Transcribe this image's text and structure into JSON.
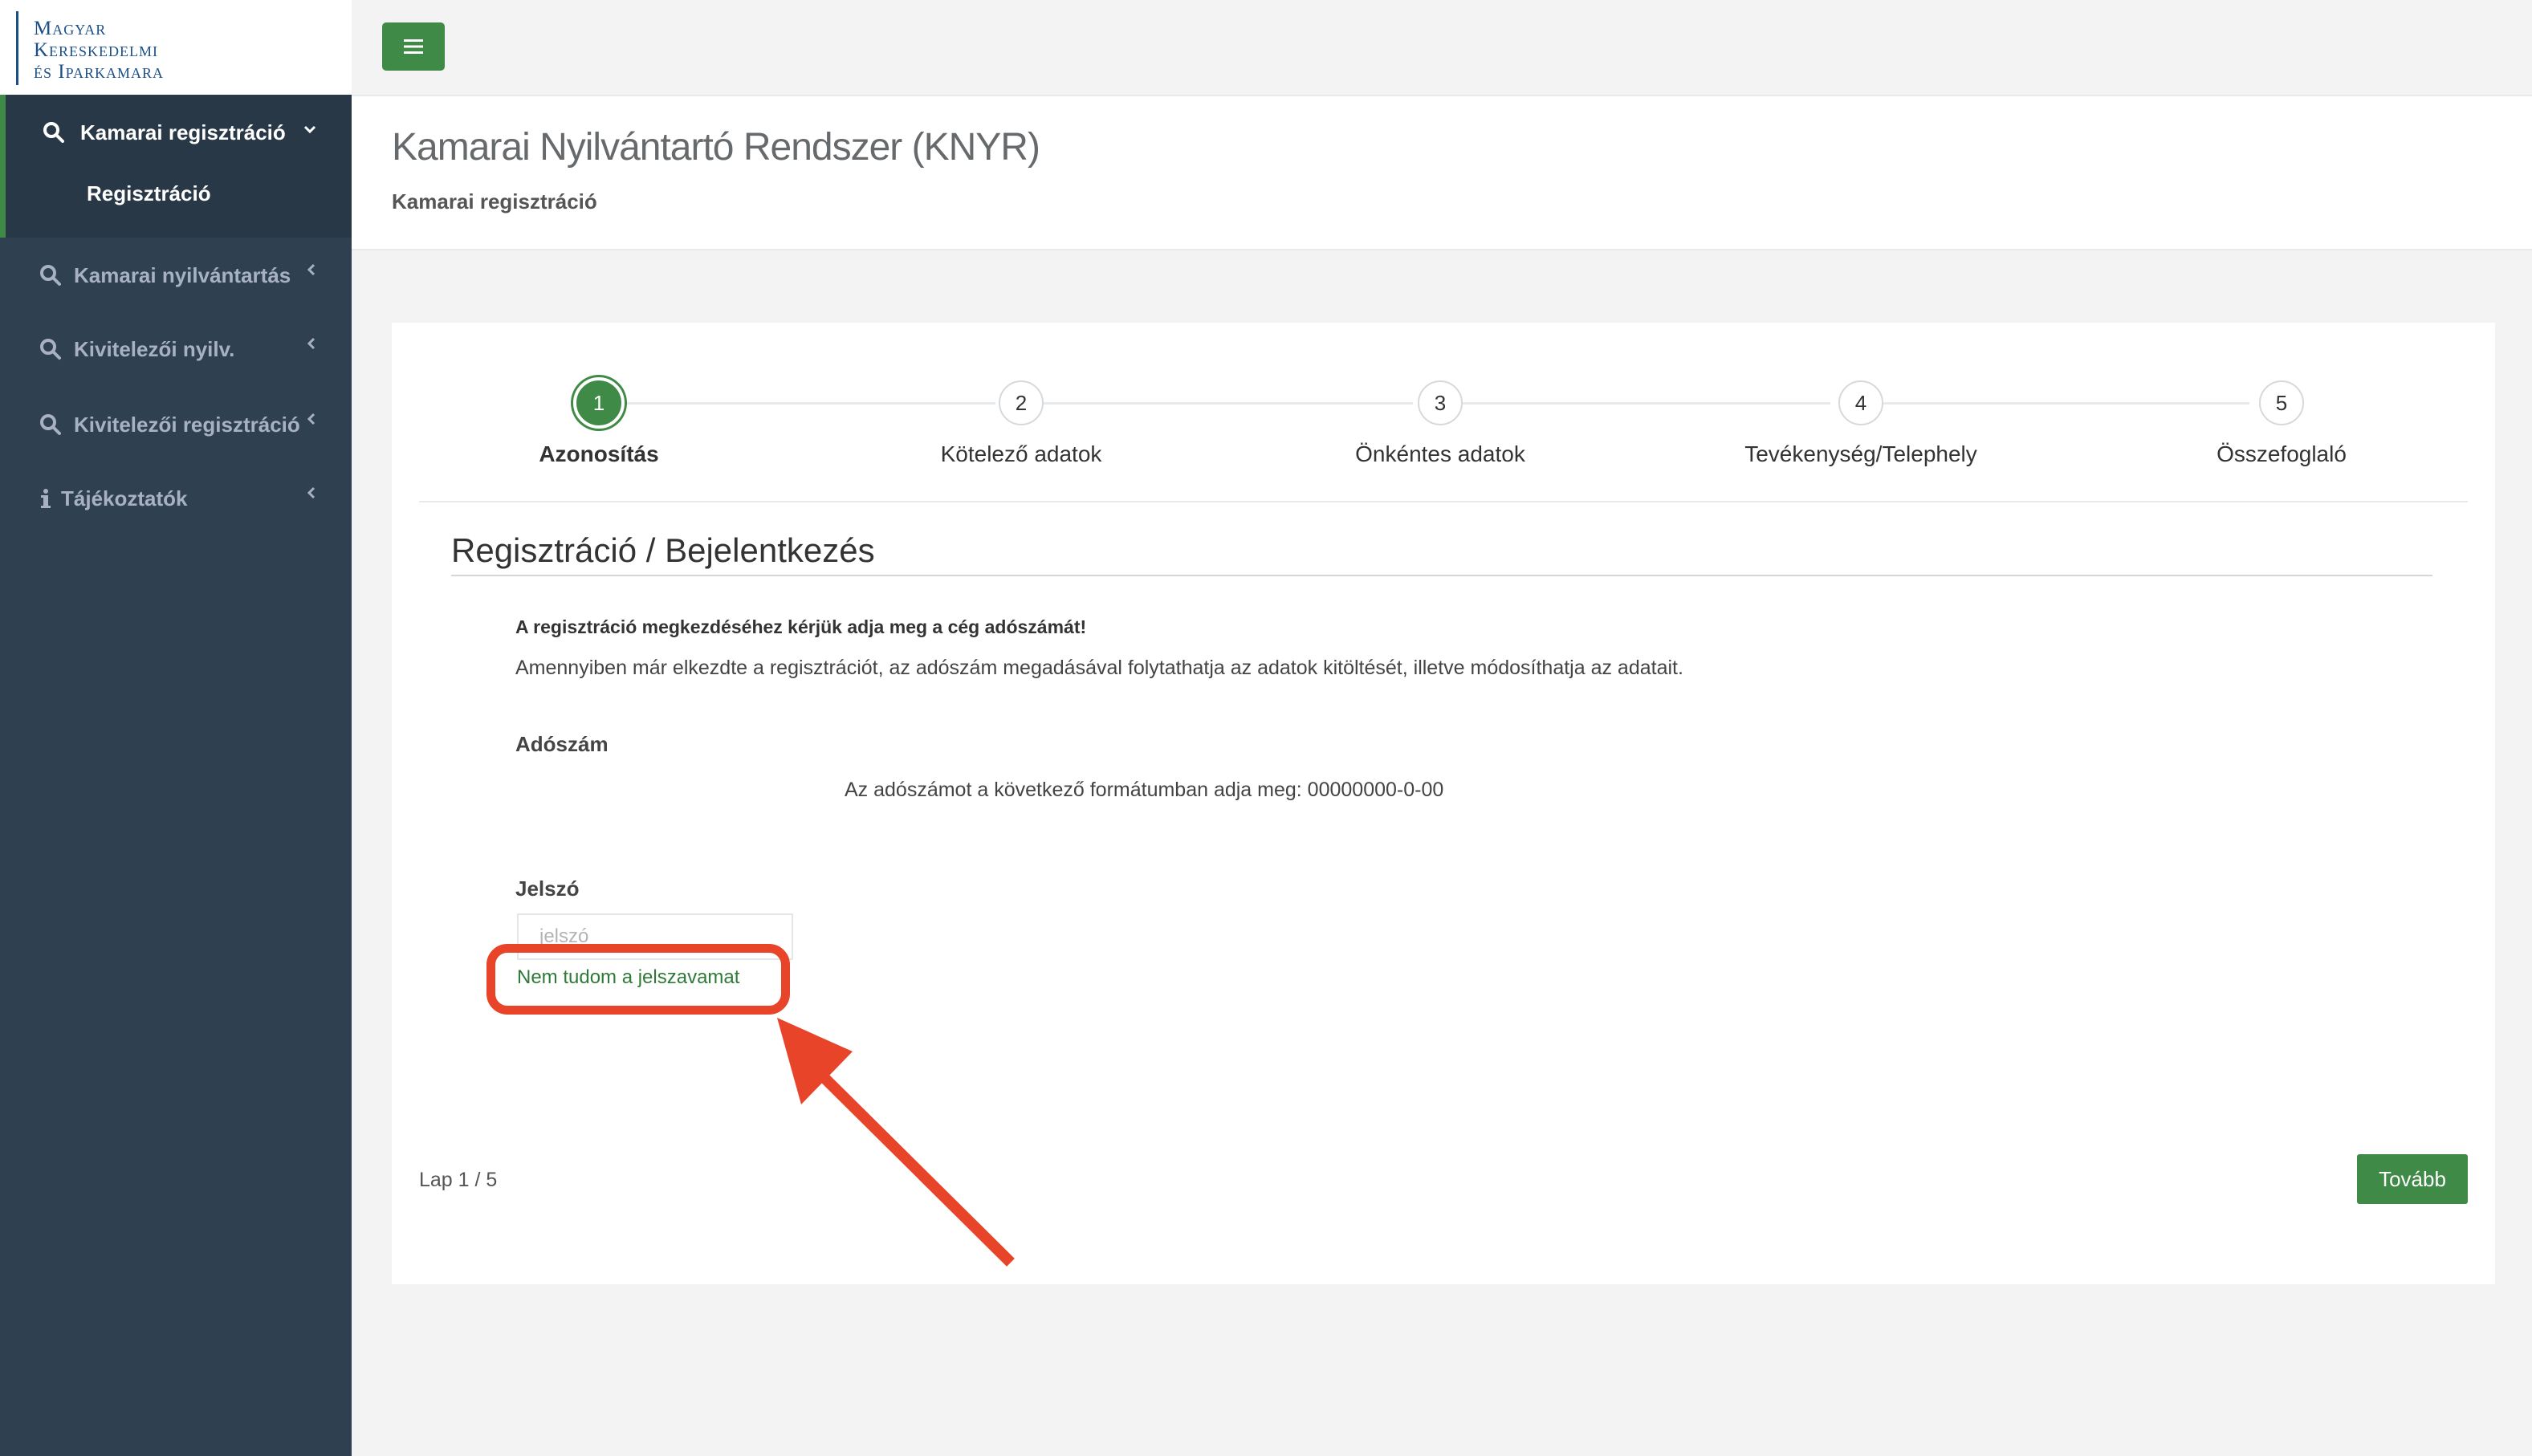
{
  "logo": {
    "lines": [
      "Magyar",
      "Kereskedelmi",
      "és Iparkamara"
    ]
  },
  "sidebar": {
    "items": [
      {
        "label": "Kamarai regisztráció",
        "icon": "search-icon",
        "arrow": "chevron-down-icon",
        "active": true
      },
      {
        "label": "Kamarai nyilvántartás",
        "icon": "search-icon",
        "arrow": "chevron-left-icon"
      },
      {
        "label": "Kivitelezői nyilv.",
        "icon": "search-icon",
        "arrow": "chevron-left-icon"
      },
      {
        "label": "Kivitelezői regisztráció",
        "icon": "search-icon",
        "arrow": "chevron-left-icon"
      },
      {
        "label": "Tájékoztatók",
        "icon": "info-icon",
        "arrow": "chevron-left-icon"
      }
    ],
    "subitem": "Regisztráció"
  },
  "topbar": {
    "menu_icon": "hamburger-icon"
  },
  "header": {
    "title": "Kamarai Nyilvántartó Rendszer (KNYR)",
    "breadcrumb": "Kamarai regisztráció"
  },
  "wizard": {
    "steps": [
      {
        "number": "1",
        "label": "Azonosítás",
        "active": true
      },
      {
        "number": "2",
        "label": "Kötelező adatok"
      },
      {
        "number": "3",
        "label": "Önkéntes adatok"
      },
      {
        "number": "4",
        "label": "Tevékenység/Telephely"
      },
      {
        "number": "5",
        "label": "Összefoglaló"
      }
    ]
  },
  "form": {
    "section_title": "Regisztráció / Bejelentkezés",
    "intro_bold": "A regisztráció megkezdéséhez kérjük adja meg a cég adószámát!",
    "intro_text": "Amennyiben már elkezdte a regisztrációt, az adószám megadásával folytathatja az adatok kitöltését, illetve módosíthatja az adatait.",
    "tax_label": "Adószám",
    "tax_hint": "Az adószámot a következő formátumban adja meg: 00000000-0-00",
    "password_label": "Jelszó",
    "password_placeholder": "jelszó",
    "forgot_link": "Nem tudom a jelszavamat"
  },
  "footer": {
    "page_indicator": "Lap 1 / 5",
    "next_button": "Tovább"
  },
  "colors": {
    "sidebar_bg": "#2f4050",
    "accent_green": "#3e8a46",
    "annotation_red": "#e8442a"
  }
}
